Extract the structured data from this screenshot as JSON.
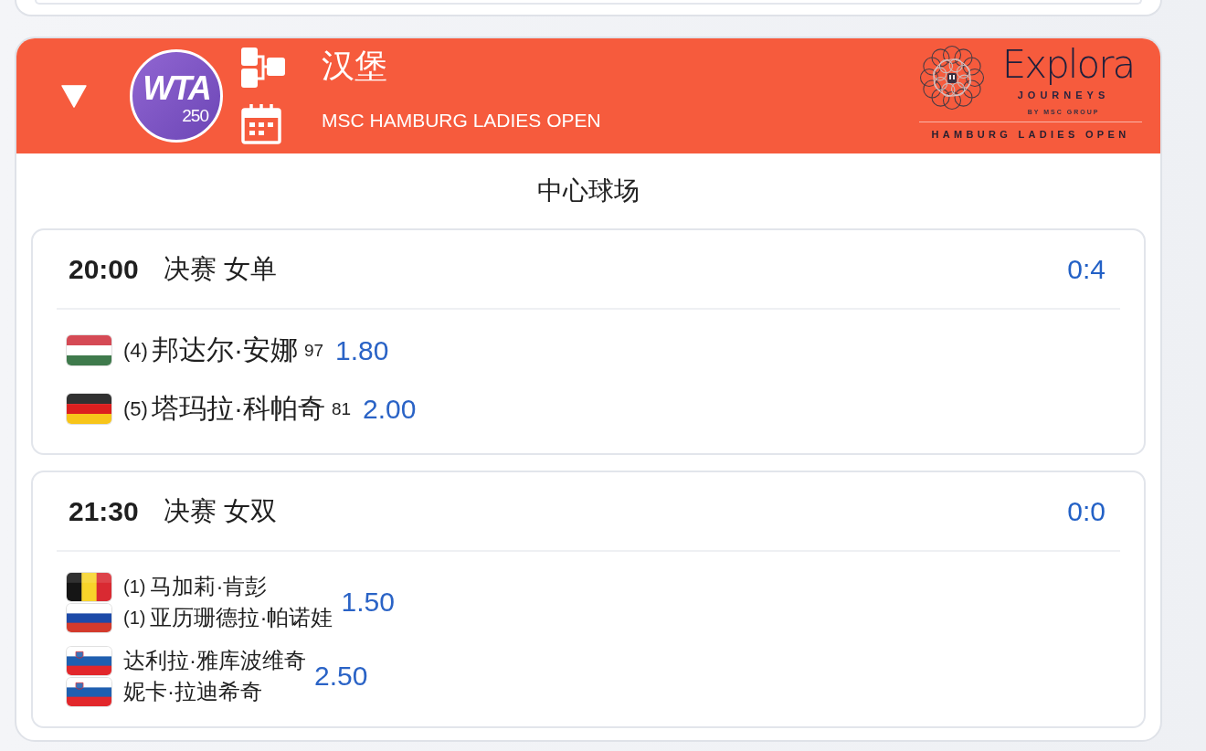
{
  "tournament": {
    "expanded": true,
    "logo": {
      "wordmark": "WTA",
      "tier": "250"
    },
    "city": "汉堡",
    "name": "MSC HAMBURG LADIES OPEN",
    "sponsor": {
      "wordmark": "Explora",
      "tagline": "JOURNEYS",
      "byline": "BY MSC GROUP",
      "event": "HAMBURG LADIES OPEN"
    }
  },
  "court": "中心球场",
  "matches": [
    {
      "kind": "singles",
      "time": "20:00",
      "round": "决赛 女单",
      "score": "0:4",
      "entries": [
        {
          "players": [
            {
              "kind": "hungary",
              "seed": "(4)",
              "name": "邦达尔·安娜",
              "rank": "97"
            }
          ],
          "odds": "1.80"
        },
        {
          "players": [
            {
              "kind": "germany",
              "seed": "(5)",
              "name": "塔玛拉·科帕奇",
              "rank": "81"
            }
          ],
          "odds": "2.00"
        }
      ]
    },
    {
      "kind": "doubles",
      "time": "21:30",
      "round": "决赛 女双",
      "score": "0:0",
      "entries": [
        {
          "players": [
            {
              "kind": "belgium",
              "seed": "(1)",
              "name": "马加莉·肯彭"
            },
            {
              "kind": "russia",
              "seed": "(1)",
              "name": "亚历珊德拉·帕诺娃"
            }
          ],
          "odds": "1.50"
        },
        {
          "players": [
            {
              "kind": "slovenia",
              "name": "达利拉·雅库波维奇"
            },
            {
              "kind": "slovenia",
              "name": "妮卡·拉迪希奇"
            }
          ],
          "odds": "2.50"
        }
      ]
    }
  ]
}
